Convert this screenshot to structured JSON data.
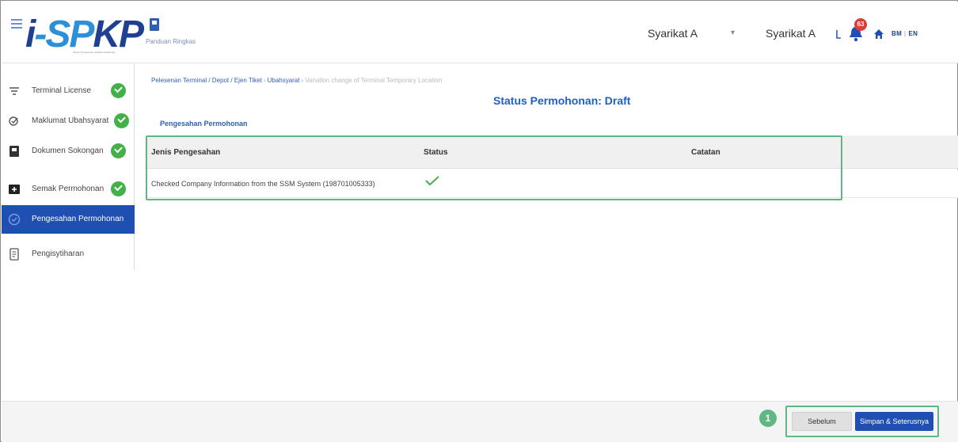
{
  "header": {
    "logo_text": "i-SPKP",
    "logo_sub": "Sistem Pengurusan Kawalan Pelabuhan",
    "guide_label": "Panduan Ringkas",
    "company_primary": "Syarikat A",
    "company_secondary": "Syarikat A",
    "notification_count": "63",
    "lang_bm": "BM",
    "lang_en": "EN"
  },
  "sidebar": {
    "items": [
      {
        "label": "Terminal License",
        "done": true,
        "icon": "filter-icon"
      },
      {
        "label": "Maklumat Ubahsyarat",
        "done": true,
        "icon": "edit-check-icon"
      },
      {
        "label": "Dokumen Sokongan",
        "done": true,
        "icon": "document-icon"
      },
      {
        "label": "Semak Permohonan",
        "done": true,
        "icon": "review-icon"
      },
      {
        "label": "Pengesahan Permohonan",
        "done": false,
        "active": true,
        "icon": "verify-icon"
      },
      {
        "label": "Pengisytiharan",
        "done": false,
        "icon": "declaration-icon"
      }
    ]
  },
  "main": {
    "breadcrumb": {
      "b1": "Pelesenan Terminal / Depot / Ejen Tiket",
      "b2": "Ubahsyarat",
      "current": "Variation change of Terminal Temporary Location"
    },
    "status_title": "Status Permohonan: Draft",
    "section_title": "Pengesahan Permohonan",
    "table": {
      "columns": [
        "Jenis Pengesahan",
        "Status",
        "Catatan"
      ],
      "rows": [
        {
          "type": "Checked Company Information from the SSM System (198701005333)",
          "status": "check",
          "note": ""
        }
      ]
    }
  },
  "footer": {
    "step_number": "1",
    "prev_label": "Sebelum",
    "next_label": "Simpan & Seterusnya"
  },
  "colors": {
    "primary": "#1f4fb0",
    "success": "#43b049",
    "highlight": "#5fb884",
    "badge": "#e53935"
  }
}
